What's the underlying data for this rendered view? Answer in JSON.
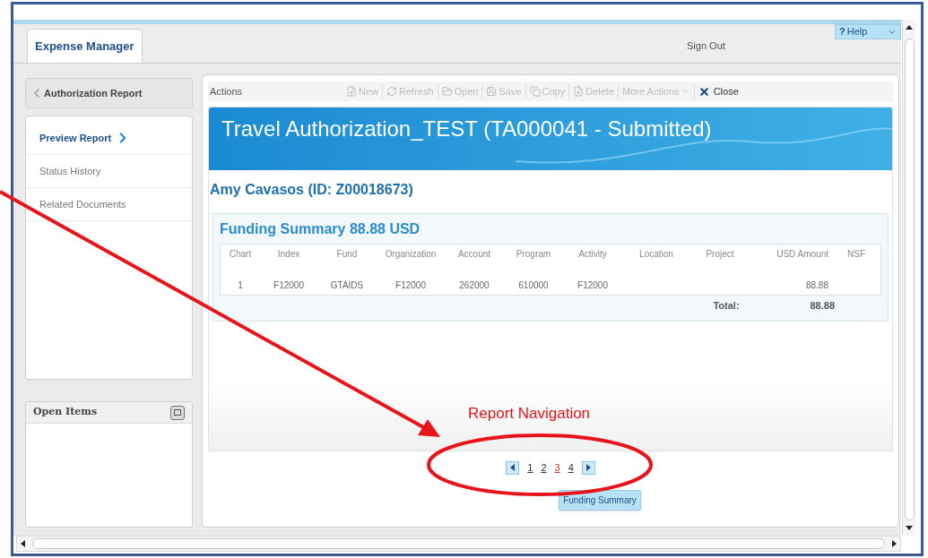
{
  "app_tab": {
    "label": "Expense Manager",
    "selected": true
  },
  "header": {
    "sign_out": "Sign Out",
    "help_mark": "?",
    "help": "Help"
  },
  "sidebar": {
    "back_button": "Authorization Report",
    "items": [
      {
        "label": "Preview Report",
        "selected": true
      },
      {
        "label": "Status History",
        "selected": false
      },
      {
        "label": "Related Documents",
        "selected": false
      }
    ],
    "open_items": {
      "title": "Open Items"
    }
  },
  "toolbar": {
    "label": "Actions",
    "buttons": [
      {
        "kind": "new",
        "label": "New",
        "disabled": true
      },
      {
        "kind": "refresh",
        "label": "Refresh",
        "disabled": true
      },
      {
        "kind": "open",
        "label": "Open",
        "disabled": true
      },
      {
        "kind": "save",
        "label": "Save",
        "disabled": true
      },
      {
        "kind": "copy",
        "label": "Copy",
        "disabled": true
      },
      {
        "kind": "delete",
        "label": "Delete",
        "disabled": true
      },
      {
        "kind": "menu",
        "label": "More Actions",
        "disabled": true
      },
      {
        "kind": "close",
        "label": "Close",
        "disabled": false
      }
    ]
  },
  "report": {
    "title": "Travel Authorization_TEST (TA000041 - Submitted)",
    "person": "Amy Cavasos (ID: Z00018673)",
    "funding": {
      "title": "Funding Summary 88.88 USD",
      "columns": [
        "Chart",
        "Index",
        "Fund",
        "Organization",
        "Account",
        "Program",
        "Activity",
        "Location",
        "Project",
        "USD Amount",
        "NSF"
      ],
      "rows": [
        {
          "cells": [
            "1",
            "F12000",
            "GTAIDS",
            "F12000",
            "262000",
            "610000",
            "F12000",
            null,
            null,
            "88.88",
            null
          ]
        }
      ],
      "total_label": "Total:",
      "total_value": "88.88"
    }
  },
  "pagination": {
    "pages": [
      {
        "label": "1",
        "selected": false
      },
      {
        "label": "2",
        "selected": false
      },
      {
        "label": "3",
        "selected": true
      },
      {
        "label": "4",
        "selected": false
      }
    ]
  },
  "section_tab": "Funding Summary",
  "annotation": {
    "label": "Report Navigation"
  }
}
